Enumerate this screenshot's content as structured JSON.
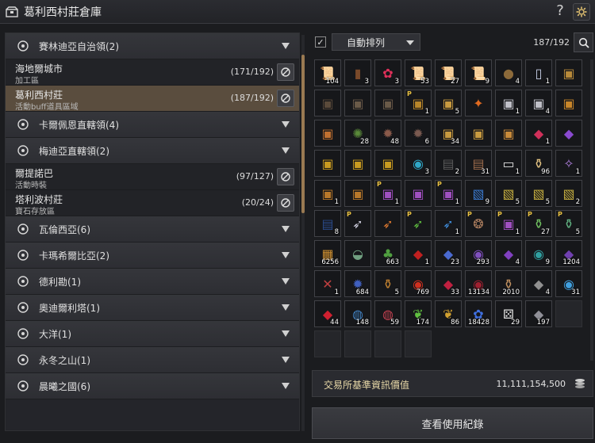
{
  "window": {
    "title": "葛利西村莊倉庫",
    "help_label": "?"
  },
  "regions": [
    {
      "label": "賽林迪亞自治領(2)",
      "icon": "eagle-crest-icon",
      "towns": [
        {
          "name": "海地爾城市",
          "sub": "加工區",
          "count": "(171/192)"
        },
        {
          "name": "葛利西村莊",
          "sub": "活動buff道具區域",
          "count": "(187/192)",
          "selected": true
        }
      ]
    },
    {
      "label": "卡爾佩恩直轄領(4)",
      "icon": "winged-crest-icon",
      "towns": []
    },
    {
      "label": "梅迪亞直轄領(2)",
      "icon": "crescent-crest-icon",
      "towns": [
        {
          "name": "爾提諾巴",
          "sub": "活動時裝",
          "count": "(97/127)"
        },
        {
          "name": "塔利波村莊",
          "sub": "寶石存放區",
          "count": "(20/24)"
        }
      ]
    },
    {
      "label": "瓦倫西亞(6)",
      "icon": "sun-crest-icon",
      "towns": []
    },
    {
      "label": "卡瑪希爾比亞(2)",
      "icon": "tree-crest-icon",
      "towns": []
    },
    {
      "label": "德利勘(1)",
      "icon": "mountain-crest-icon",
      "towns": []
    },
    {
      "label": "奧迪爾利塔(1)",
      "icon": "leaf-crest-icon",
      "towns": []
    },
    {
      "label": "大洋(1)",
      "icon": "wave-crest-icon",
      "towns": []
    },
    {
      "label": "永冬之山(1)",
      "icon": "snowflake-crest-icon",
      "towns": []
    },
    {
      "label": "晨曦之國(6)",
      "icon": "dawn-crest-icon",
      "towns": []
    }
  ],
  "toolbar": {
    "auto_sort_label": "自動排列",
    "auto_sort_checked": true,
    "capacity": "187/192"
  },
  "items": [
    {
      "icon": "scroll-icon",
      "glyph": "📜",
      "color": "#d6cfb8",
      "qty": "104"
    },
    {
      "icon": "book-icon",
      "glyph": "▮",
      "color": "#7a4a2a",
      "qty": "3"
    },
    {
      "icon": "rose-icon",
      "glyph": "✿",
      "color": "#e0305a",
      "qty": "3"
    },
    {
      "icon": "scroll-icon",
      "glyph": "📜",
      "color": "#d6cfb8",
      "qty": "53"
    },
    {
      "icon": "scroll-icon",
      "glyph": "📜",
      "color": "#d6cfb8",
      "qty": "27"
    },
    {
      "icon": "scroll-icon",
      "glyph": "📜",
      "color": "#d6cfb8",
      "qty": "9"
    },
    {
      "icon": "coin-pouch-icon",
      "glyph": "●",
      "color": "#8c6a3a",
      "qty": "4"
    },
    {
      "icon": "milk-bottle-icon",
      "glyph": "▯",
      "color": "#c8d0e8",
      "qty": "1"
    },
    {
      "icon": "chest-icon",
      "glyph": "▣",
      "color": "#b88a3a",
      "qty": ""
    },
    {
      "icon": "chest-icon",
      "glyph": "▣",
      "color": "#5a4a3a",
      "qty": ""
    },
    {
      "icon": "chest-icon",
      "glyph": "▣",
      "color": "#6a5a48",
      "qty": ""
    },
    {
      "icon": "chest-icon",
      "glyph": "▣",
      "color": "#6a5a48",
      "qty": ""
    },
    {
      "icon": "chest-icon",
      "glyph": "▣",
      "color": "#b8862a",
      "qty": "1",
      "p": true
    },
    {
      "icon": "chest-icon",
      "glyph": "▣",
      "color": "#c89a40",
      "qty": "5"
    },
    {
      "icon": "phoenix-icon",
      "glyph": "✦",
      "color": "#e06a20",
      "qty": ""
    },
    {
      "icon": "chest-icon",
      "glyph": "▣",
      "color": "#c0c0c8",
      "qty": "1"
    },
    {
      "icon": "chest-icon",
      "glyph": "▣",
      "color": "#c0c0c8",
      "qty": "4"
    },
    {
      "icon": "chest-icon",
      "glyph": "▣",
      "color": "#c8862a",
      "qty": ""
    },
    {
      "icon": "chest-icon",
      "glyph": "▣",
      "color": "#c07030",
      "qty": ""
    },
    {
      "icon": "emblem-icon",
      "glyph": "✺",
      "color": "#5a8a3a",
      "qty": "28"
    },
    {
      "icon": "gear-box-icon",
      "glyph": "✹",
      "color": "#8a5a4a",
      "qty": "48"
    },
    {
      "icon": "gear-box-icon",
      "glyph": "✹",
      "color": "#7a5a50",
      "qty": "6"
    },
    {
      "icon": "chest-icon",
      "glyph": "▣",
      "color": "#c89a40",
      "qty": "34"
    },
    {
      "icon": "chest-icon",
      "glyph": "▣",
      "color": "#c89a40",
      "qty": ""
    },
    {
      "icon": "chest-icon",
      "glyph": "▣",
      "color": "#c88a3a",
      "qty": ""
    },
    {
      "icon": "gem-pouch-icon",
      "glyph": "◆",
      "color": "#d0305a",
      "qty": "1"
    },
    {
      "icon": "crystal-icon",
      "glyph": "◆",
      "color": "#8a4ad0",
      "qty": ""
    },
    {
      "icon": "chest-icon",
      "glyph": "▣",
      "color": "#c89a20",
      "qty": ""
    },
    {
      "icon": "chest-icon",
      "glyph": "▣",
      "color": "#c89a20",
      "qty": ""
    },
    {
      "icon": "chest-icon",
      "glyph": "▣",
      "color": "#c89a20",
      "qty": ""
    },
    {
      "icon": "orb-icon",
      "glyph": "◉",
      "color": "#30a8c8",
      "qty": "3"
    },
    {
      "icon": "tome-icon",
      "glyph": "▤",
      "color": "#5a5a5a",
      "qty": "2"
    },
    {
      "icon": "ledger-icon",
      "glyph": "▤",
      "color": "#9a6a4a",
      "qty": "31"
    },
    {
      "icon": "document-icon",
      "glyph": "▭",
      "color": "#e0e0e0",
      "qty": "1"
    },
    {
      "icon": "potion-icon",
      "glyph": "⚱",
      "color": "#e0c080",
      "qty": "96"
    },
    {
      "icon": "gift-bag-icon",
      "glyph": "✧",
      "color": "#b080e0",
      "qty": "1"
    },
    {
      "icon": "chest-icon",
      "glyph": "▣",
      "color": "#b8782a",
      "qty": "1"
    },
    {
      "icon": "chest-icon",
      "glyph": "▣",
      "color": "#b8782a",
      "qty": ""
    },
    {
      "icon": "chest-icon",
      "glyph": "▣",
      "color": "#a050c0",
      "qty": "1",
      "p": true
    },
    {
      "icon": "chest-icon",
      "glyph": "▣",
      "color": "#a050c0",
      "qty": ""
    },
    {
      "icon": "chest-icon",
      "glyph": "▣",
      "color": "#a050c0",
      "qty": "1",
      "p": true
    },
    {
      "icon": "blue-card-icon",
      "glyph": "▧",
      "color": "#3a7ad0",
      "qty": "9"
    },
    {
      "icon": "gold-card-icon",
      "glyph": "▧",
      "color": "#c8b040",
      "qty": "5"
    },
    {
      "icon": "gold-card-icon",
      "glyph": "▧",
      "color": "#c8b040",
      "qty": "5"
    },
    {
      "icon": "gold-card-icon",
      "glyph": "▧",
      "color": "#c8b040",
      "qty": "2"
    },
    {
      "icon": "blue-book-icon",
      "glyph": "▤",
      "color": "#2a4a8a",
      "qty": "8"
    },
    {
      "icon": "feather-icon",
      "glyph": "➶",
      "color": "#d0d0e0",
      "qty": "",
      "p": true
    },
    {
      "icon": "feather-icon",
      "glyph": "➶",
      "color": "#e07a30",
      "qty": ""
    },
    {
      "icon": "feather-icon",
      "glyph": "➶",
      "color": "#60c040",
      "qty": "",
      "p": true
    },
    {
      "icon": "feather-icon",
      "glyph": "➶",
      "color": "#4090e0",
      "qty": "1"
    },
    {
      "icon": "paw-badge-icon",
      "glyph": "❂",
      "color": "#b08060",
      "qty": "",
      "p": true
    },
    {
      "icon": "chest-icon",
      "glyph": "▣",
      "color": "#a050c0",
      "qty": "1",
      "p": true
    },
    {
      "icon": "elixir-icon",
      "glyph": "⚱",
      "color": "#70c060",
      "qty": "27",
      "p": true
    },
    {
      "icon": "elixir-icon",
      "glyph": "⚱",
      "color": "#60b080",
      "qty": "5",
      "p": true
    },
    {
      "icon": "cube-icon",
      "glyph": "▦",
      "color": "#d09030",
      "qty": "6256"
    },
    {
      "icon": "bowl-icon",
      "glyph": "◒",
      "color": "#70a080",
      "qty": ""
    },
    {
      "icon": "seedling-icon",
      "glyph": "♣",
      "color": "#50a040",
      "qty": "663"
    },
    {
      "icon": "red-stone-icon",
      "glyph": "◆",
      "color": "#c02020",
      "qty": "1"
    },
    {
      "icon": "blue-shard-icon",
      "glyph": "◆",
      "color": "#4a6ad0",
      "qty": "23"
    },
    {
      "icon": "purple-orb-icon",
      "glyph": "◉",
      "color": "#8050c0",
      "qty": "293"
    },
    {
      "icon": "purple-gem-icon",
      "glyph": "◆",
      "color": "#8040c0",
      "qty": "4"
    },
    {
      "icon": "teal-orb-icon",
      "glyph": "◉",
      "color": "#30a0a0",
      "qty": "9"
    },
    {
      "icon": "purple-crystal-icon",
      "glyph": "◆",
      "color": "#7040b0",
      "qty": "1204"
    },
    {
      "icon": "crossed-tools-icon",
      "glyph": "✕",
      "color": "#c04040",
      "qty": "1"
    },
    {
      "icon": "blue-rune-icon",
      "glyph": "✹",
      "color": "#4060c0",
      "qty": "684"
    },
    {
      "icon": "gold-flask-icon",
      "glyph": "⚱",
      "color": "#c08030",
      "qty": "5"
    },
    {
      "icon": "red-essence-icon",
      "glyph": "◉",
      "color": "#d03020",
      "qty": "769"
    },
    {
      "icon": "red-shard-icon",
      "glyph": "◆",
      "color": "#c02040",
      "qty": "33"
    },
    {
      "icon": "dark-orb-icon",
      "glyph": "◉",
      "color": "#a02030",
      "qty": "13134"
    },
    {
      "icon": "jar-icon",
      "glyph": "⚱",
      "color": "#c09060",
      "qty": "2010"
    },
    {
      "icon": "grey-ore-icon",
      "glyph": "◆",
      "color": "#909090",
      "qty": "4"
    },
    {
      "icon": "water-orb-icon",
      "glyph": "◉",
      "color": "#40a0e0",
      "qty": "31"
    },
    {
      "icon": "red-gem-icon",
      "glyph": "◆",
      "color": "#d02030",
      "qty": "44"
    },
    {
      "icon": "pearl-dish-icon",
      "glyph": "◍",
      "color": "#4080c0",
      "qty": "148"
    },
    {
      "icon": "clam-icon",
      "glyph": "◍",
      "color": "#c04050",
      "qty": "59"
    },
    {
      "icon": "green-leaf-icon",
      "glyph": "❦",
      "color": "#60c040",
      "qty": "174"
    },
    {
      "icon": "gold-leaf-icon",
      "glyph": "❦",
      "color": "#d0a030",
      "qty": "86"
    },
    {
      "icon": "blue-flower-icon",
      "glyph": "✿",
      "color": "#4070e0",
      "qty": "18428"
    },
    {
      "icon": "dice-icon",
      "glyph": "⚄",
      "color": "#e0e0e0",
      "qty": "29"
    },
    {
      "icon": "grey-stone-icon",
      "glyph": "◆",
      "color": "#909098",
      "qty": "197"
    }
  ],
  "empty_slot_count": 5,
  "market": {
    "label": "交易所基準資訊價值",
    "value": "11,111,154,500",
    "icon": "silver-coins-icon"
  },
  "log_button_label": "查看使用紀錄"
}
